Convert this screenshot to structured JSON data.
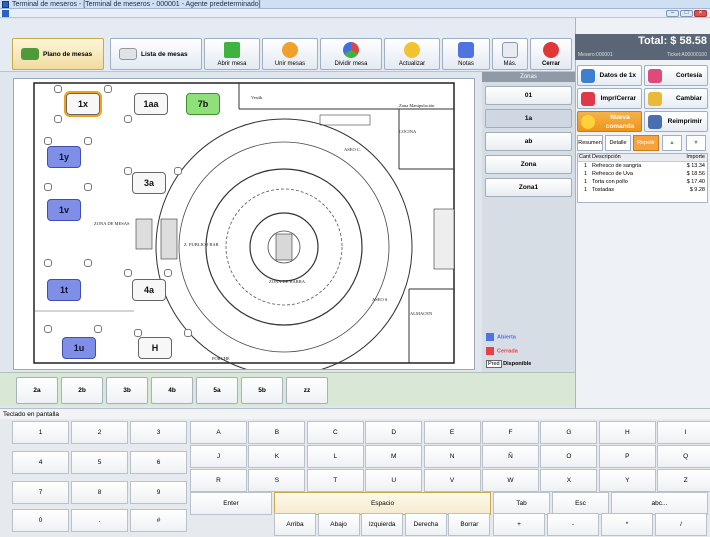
{
  "window": {
    "title": "Terminal de meseros - [Terminal de meseros - 000001 - Agente predeterminado]"
  },
  "toolbar": {
    "buttons": [
      {
        "label": "Plano de mesas"
      },
      {
        "label": "Lista de mesas"
      },
      {
        "label": "Abrir mesa"
      },
      {
        "label": "Unir mesas"
      },
      {
        "label": "Dividir mesa"
      },
      {
        "label": "Actualizar"
      },
      {
        "label": "Notas"
      },
      {
        "label": "Más."
      },
      {
        "label": "Cerrar"
      }
    ]
  },
  "floor": {
    "tables": [
      {
        "label": "1x",
        "state": "selected"
      },
      {
        "label": "1aa",
        "state": "normal"
      },
      {
        "label": "7b",
        "state": "free"
      },
      {
        "label": "1y",
        "state": "occupied"
      },
      {
        "label": "3a",
        "state": "normal"
      },
      {
        "label": "1v",
        "state": "occupied"
      },
      {
        "label": "1t",
        "state": "occupied"
      },
      {
        "label": "4a",
        "state": "normal"
      },
      {
        "label": "1u",
        "state": "occupied"
      },
      {
        "label": "H",
        "state": "normal"
      }
    ],
    "labels": {
      "zona_mesas": "ZONA DE MESAS",
      "publico_bar": "Z. PUBLICO BAR",
      "zona_barra": "ZONA DE BARRA",
      "cocina": "COCINA",
      "almacen": "ALMACEN",
      "aseo_c": "ASEO C.",
      "aseo_s": "ASEO S.",
      "porche": "PORCHE",
      "vestibulo": "Vestíb.",
      "manipulacion": "Zona Manipulación"
    }
  },
  "zones": {
    "header": "Zonas",
    "items": [
      {
        "label": "01"
      },
      {
        "label": "1a"
      },
      {
        "label": "ab"
      },
      {
        "label": "Zona"
      },
      {
        "label": "Zona1"
      }
    ],
    "legend": {
      "abierta": "Abierta",
      "cerrada": "Cerrada",
      "pred": "Pred",
      "disponible": "Disponible"
    },
    "colors": {
      "abierta": "#4f74e0",
      "cerrada": "#e8404a"
    }
  },
  "bottom_tables": [
    {
      "label": "2a"
    },
    {
      "label": "2b"
    },
    {
      "label": "3b"
    },
    {
      "label": "4b"
    },
    {
      "label": "5a"
    },
    {
      "label": "5b"
    },
    {
      "label": "zz"
    }
  ],
  "panel": {
    "total": "Total: $ 58.58",
    "mesero": "Mesero:000001",
    "ticket": "Ticket:A00000100",
    "buttons": {
      "datos": "Datos de 1x",
      "cortesia": "Cortesía",
      "impr": "Impr/Cerrar",
      "cambiar": "Cambiar",
      "nueva": "Nueva comanda",
      "reimprimir": "Reimprimir"
    },
    "tabs": {
      "resumen": "Resumen",
      "detalle": "Detalle",
      "repetir": "Repetir"
    },
    "order_headers": {
      "cant": "Cant",
      "desc": "Descripción",
      "importe": "Importe"
    },
    "orders": [
      {
        "cant": "1",
        "desc": "Refresco de sangria",
        "importe": "$ 13.34"
      },
      {
        "cant": "1",
        "desc": "Refresco de Uva",
        "importe": "$ 18.56"
      },
      {
        "cant": "1",
        "desc": "Torta con pollo",
        "importe": "$ 17.40"
      },
      {
        "cant": "1",
        "desc": "Tostadas",
        "importe": "$ 9.28"
      }
    ]
  },
  "keyboard": {
    "title": "Teclado en pantalla",
    "numpad": [
      "1",
      "2",
      "3",
      "4",
      "5",
      "6",
      "7",
      "8",
      "9",
      "0",
      ".",
      "#"
    ],
    "row1": [
      "A",
      "B",
      "C",
      "D",
      "E",
      "F",
      "G",
      "H",
      "I"
    ],
    "row2": [
      "J",
      "K",
      "L",
      "M",
      "N",
      "Ñ",
      "O",
      "P",
      "Q"
    ],
    "row3": [
      "R",
      "S",
      "T",
      "U",
      "V",
      "W",
      "X",
      "Y",
      "Z"
    ],
    "enter": "Enter",
    "space": "Espacio",
    "tab": "Tab",
    "esc": "Esc",
    "abc": "abc...",
    "arrows": [
      "Arriba",
      "Abajo",
      "Izquierda",
      "Derecha",
      "Borrar"
    ],
    "ops": [
      "+",
      "-",
      "*",
      "/"
    ]
  }
}
